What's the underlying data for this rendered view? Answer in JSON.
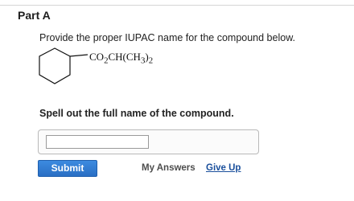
{
  "part": {
    "title": "Part A"
  },
  "question": {
    "prompt": "Provide the proper IUPAC name for the compound below.",
    "structure_label_main": "CO",
    "structure_label_sub1": "2",
    "structure_label_mid": "CH(CH",
    "structure_label_sub2": "3",
    "structure_label_end": ")",
    "structure_label_sub3": "2",
    "instruction": "Spell out the full name of the compound."
  },
  "answer": {
    "value": "",
    "placeholder": ""
  },
  "actions": {
    "submit_label": "Submit",
    "my_answers_label": "My Answers",
    "give_up_label": "Give Up"
  },
  "colors": {
    "submit_button": "#2f7bd3",
    "give_up_link": "#1a4f9c"
  }
}
